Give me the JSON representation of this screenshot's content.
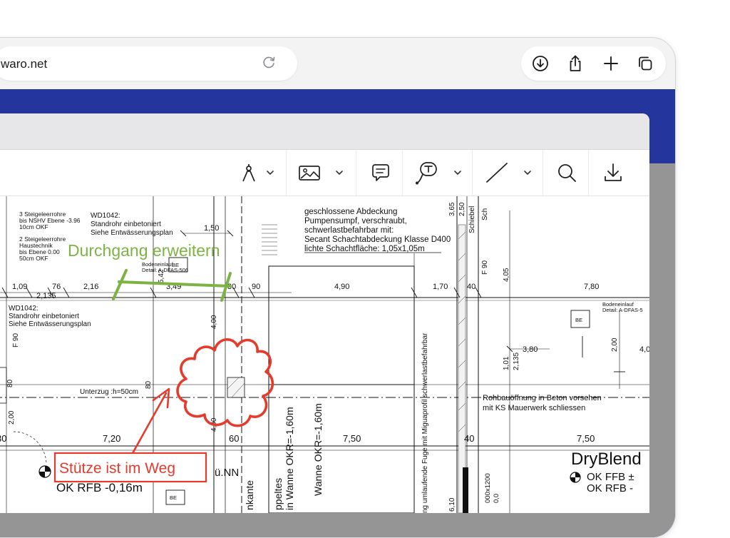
{
  "browser": {
    "url_partial": "waro.net",
    "icons": [
      "reload-icon",
      "download-icon",
      "share-icon",
      "new-tab-plus-icon",
      "tabs-overview-icon"
    ]
  },
  "toolbar": {
    "icons": [
      "pen-tool-icon",
      "image-icon",
      "comment-icon",
      "text-box-icon",
      "line-tool-icon",
      "search-icon",
      "download-icon"
    ],
    "dropdown_icon": "chevron-down-icon"
  },
  "colors": {
    "browser_blue": "#24369e",
    "annotation_green": "#7cb342",
    "annotation_red": "#e53b2c",
    "cyan_label": "#2ec6e6"
  },
  "plan": {
    "notes": {
      "steigeleer_1_l1": "3 Steigeleerrohre",
      "steigeleer_1_l2": "bis NSHV Ebene -3.96",
      "steigeleer_1_l3": "10cm OKF",
      "steigeleer_2_l1": "2 Steigeleerrohre",
      "steigeleer_2_l2": "Haustechnik",
      "steigeleer_2_l3": "bis Ebene 0.00",
      "steigeleer_2_l4": "50cm OKF",
      "wd_top_l1": "WD1042:",
      "wd_top_l2": "Standrohr einbetoniert",
      "wd_top_l3": "Siehe Entwässerungsplan",
      "wd_left_l1": "WD1042:",
      "wd_left_l2": "Standrohr einbetoniert",
      "wd_left_l3": "Siehe Entwässerungsplan",
      "abdeckung_l1": "geschlossene Abdeckung",
      "abdeckung_l2": "Pumpensumpf, verschraubt,",
      "abdeckung_l3": "schwerlastbefahrbar mit:",
      "abdeckung_l4": "Secant Schachtabdeckung Klasse D400",
      "abdeckung_l5": "lichte Schachtfläche: 1,05x1,05m",
      "bodeneinlauf_1_l1": "Bodeneinlauf",
      "bodeneinlauf_1_l2": "Detail: A-DFAS-506",
      "bodeneinlauf_2_l1": "Bodeneinlauf",
      "bodeneinlauf_2_l2": "Detail: A-DFAS-5",
      "rohbau_l1": "Rohbauöffnung in Beton vorsehen",
      "rohbau_l2": "mit KS Mauerwerk schliessen",
      "unterzug": "Unterzug :h=50cm",
      "wanne": "Wanne OKR=-1,60m",
      "fuge": "ng umlaufende Fuge mit Miguaprofil schwerlastbefahrbar",
      "doppeltes_l1": "ppeltes",
      "doppeltes_l2": "in Wanne OKR=-1,60m",
      "kante": "nkante",
      "schiebe": "Schiebel",
      "sch": "Sch",
      "f90_left": "F 90",
      "f90_mid": "F 90",
      "be_1": "BE",
      "be_2": "BE",
      "be_3": "BE",
      "ffb": "OK FFB  ±",
      "rfb_right": "OK RFB  -",
      "rfb_left": "OK RFB  -0,16m",
      "nn": "ü.NN",
      "dryblend": "DryBlend",
      "cyan_1": "000x1200",
      "cyan_2": "0,0"
    },
    "dims": {
      "d_1_50": "1,50",
      "d_1_09": "1,09",
      "d_76": "76",
      "d_2_135": "2,135",
      "d_2_16": "2,16",
      "d_3_49": "3,49",
      "d_5_42": "5,42",
      "d_30": "30",
      "d_90": "90",
      "d_4_90": "4,90",
      "d_1_70": "1,70",
      "d_40a": "40",
      "d_4_05": "4,05",
      "d_7_80": "7,80",
      "d_4_00a": "4,00",
      "d_3_80": "3,80",
      "d_2_00": "2,00",
      "d_4_0": "4,0",
      "d_1_01": "1,01",
      "d_2_135b": "2,135",
      "d_80": "80",
      "d_7_20": "7,20",
      "d_4_00b": "4,00",
      "d_60": "60",
      "d_7_50a": "7,50",
      "d_40b": "40",
      "d_7_50b": "7,50",
      "d_3_65": "3,65",
      "d_2_50": "2,50",
      "d_6_10": "6,10",
      "d_2_00b": "2,00",
      "d_30b": "30",
      "d_80b": "80"
    },
    "annotations": {
      "green_label": "Durchgang erweitern",
      "red_label": "Stütze ist im Weg"
    }
  }
}
